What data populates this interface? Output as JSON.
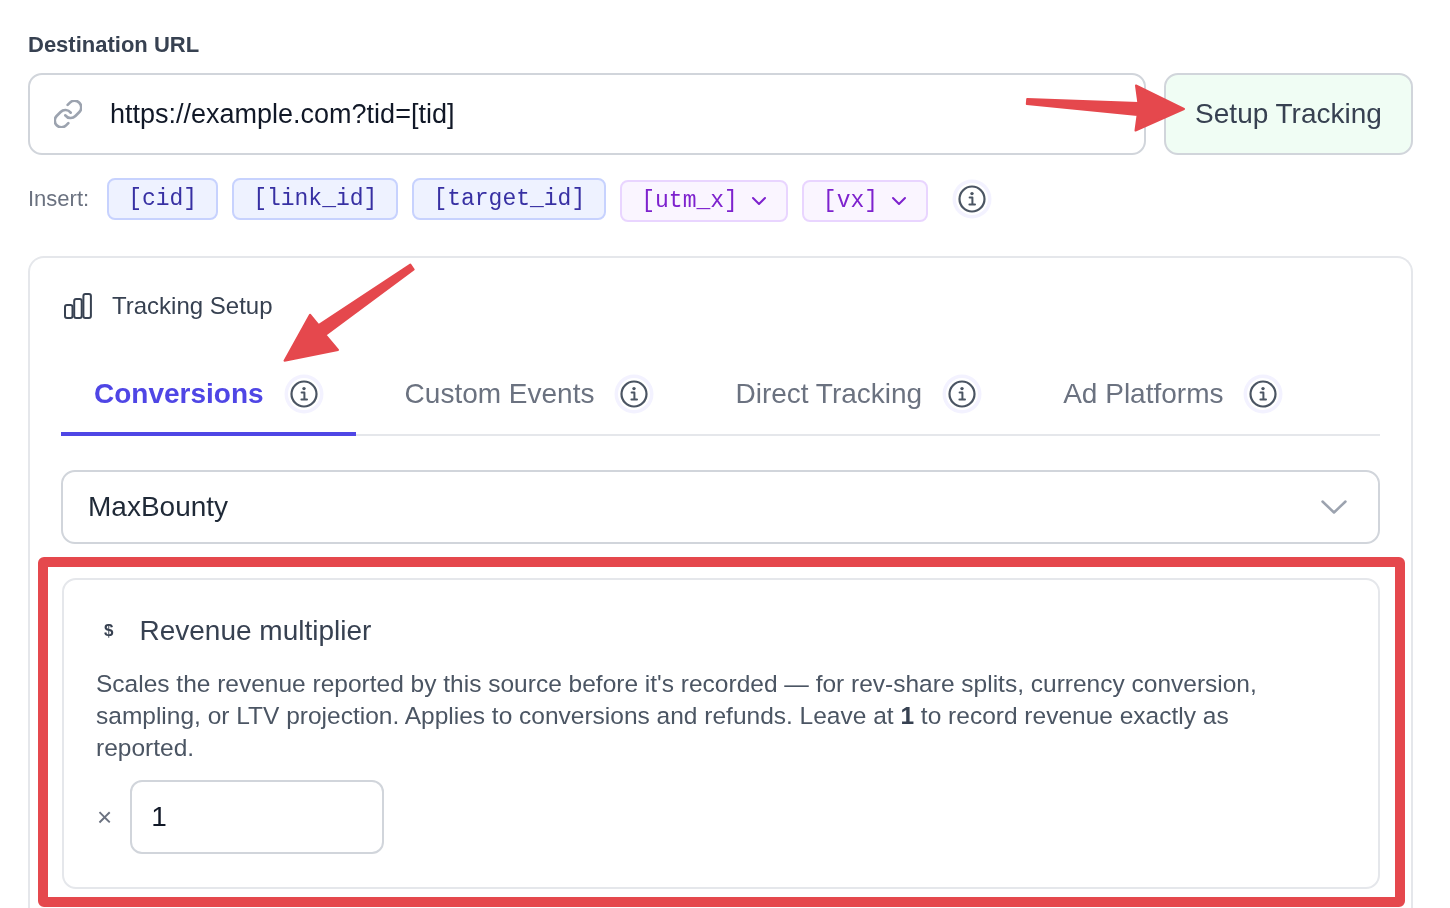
{
  "destination_url": {
    "label": "Destination URL",
    "value": "https://example.com?tid=[tid]",
    "action_button": "Setup Tracking"
  },
  "insert": {
    "label": "Insert:",
    "tokens": [
      {
        "text": "[cid]",
        "kind": "token"
      },
      {
        "text": "[link_id]",
        "kind": "token"
      },
      {
        "text": "[target_id]",
        "kind": "token"
      },
      {
        "text": "[utm_x]",
        "kind": "dropdown"
      },
      {
        "text": "[vx]",
        "kind": "dropdown"
      }
    ]
  },
  "tracking_setup": {
    "title": "Tracking Setup",
    "tabs": [
      {
        "label": "Conversions",
        "selected": true
      },
      {
        "label": "Custom Events",
        "selected": false
      },
      {
        "label": "Direct Tracking",
        "selected": false
      },
      {
        "label": "Ad Platforms",
        "selected": false
      }
    ],
    "network_select": {
      "value": "MaxBounty"
    },
    "revenue_multiplier": {
      "icon": "$",
      "title": "Revenue multiplier",
      "description": "Scales the revenue reported by this source before it's recorded — for rev-share splits, currency conversion, sampling, or LTV projection. Applies to conversions and refunds. Leave at **1** to record revenue exactly as reported.",
      "prefix": "×",
      "value": "1"
    }
  }
}
